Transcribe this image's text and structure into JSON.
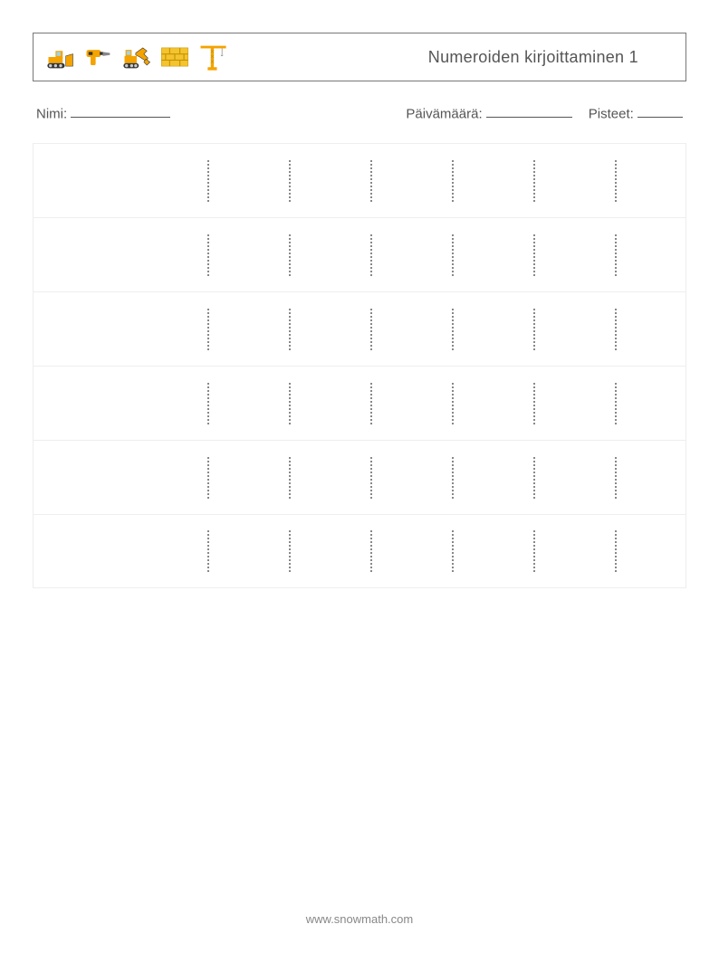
{
  "header": {
    "title": "Numeroiden kirjoittaminen 1",
    "icons": [
      {
        "name": "bulldozer-icon"
      },
      {
        "name": "drill-icon"
      },
      {
        "name": "excavator-icon"
      },
      {
        "name": "brick-wall-icon"
      },
      {
        "name": "crane-icon"
      }
    ]
  },
  "info": {
    "name_label": "Nimi:",
    "date_label": "Päivämäärä:",
    "score_label": "Pisteet:"
  },
  "grid": {
    "rows": 6,
    "cells_per_row": 6,
    "trace_character": "1"
  },
  "footer": {
    "text": "www.snowmath.com"
  }
}
